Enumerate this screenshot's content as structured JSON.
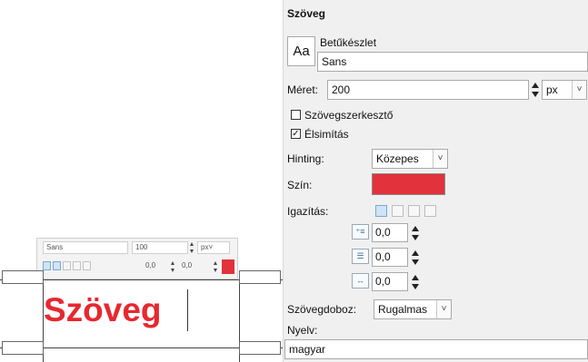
{
  "canvas": {
    "sample_text": "Szöveg",
    "mini_toolbar": {
      "font": "Sans",
      "size": "100",
      "unit": "px",
      "unit_chevron": "˅",
      "offset1": "0,0",
      "offset2": "0,0"
    }
  },
  "panel": {
    "title": "Szöveg",
    "font_section_label": "Betűkészlet",
    "font_button": "Aa",
    "font_value": "Sans",
    "size_label": "Méret:",
    "size_value": "200",
    "unit": "px",
    "chevron": "˅",
    "editor_checkbox_label": "Szövegszerkesztő",
    "editor_checked": false,
    "antialias_checkbox_label": "Élsimítás",
    "antialias_checked": true,
    "check_mark": "✓",
    "hinting_label": "Hinting:",
    "hinting_value": "Közepes",
    "color_label": "Szín:",
    "color_value": "#e2323b",
    "justify_label": "Igazítás:",
    "indent_value": "0,0",
    "line_spacing_value": "0,0",
    "letter_spacing_value": "0,0",
    "indent_icon": "⁺≡",
    "line_spacing_icon": "☰",
    "letter_spacing_icon": "↔",
    "box_label": "Szövegdoboz:",
    "box_value": "Rugalmas",
    "language_label": "Nyelv:",
    "language_value": "magyar"
  }
}
